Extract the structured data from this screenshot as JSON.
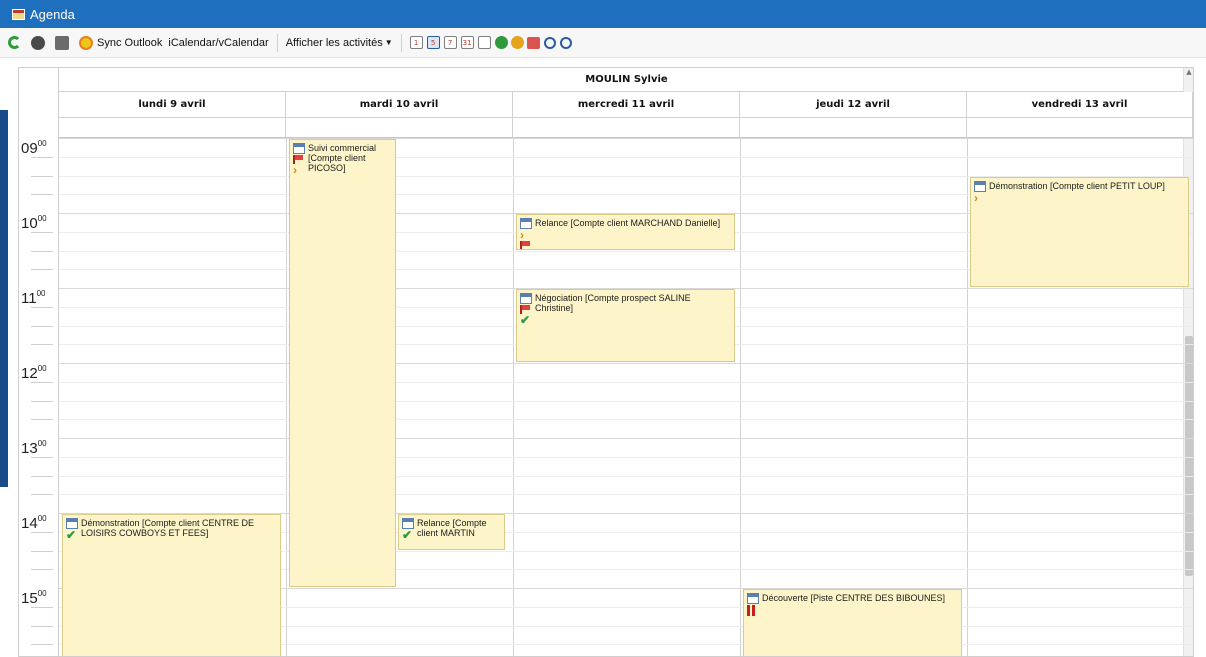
{
  "window": {
    "title": "Agenda"
  },
  "toolbar": {
    "sync_outlook": "Sync Outlook",
    "icalendar": "iCalendar/vCalendar",
    "show_activities": "Afficher les activités",
    "view_day": "1",
    "view_workweek": "5",
    "view_week": "7",
    "view_month": "31"
  },
  "calendar": {
    "owner": "MOULIN Sylvie",
    "days": [
      "lundi 9 avril",
      "mardi 10 avril",
      "mercredi 11 avril",
      "jeudi 12 avril",
      "vendredi 13 avril"
    ],
    "hours": [
      "09",
      "10",
      "11",
      "12",
      "13",
      "14",
      "15"
    ],
    "minutes_label": "00"
  },
  "events": [
    {
      "title": "Suivi commercial [Compte client PICOSO]",
      "day": "mardi 10 avril",
      "start": "09:00",
      "end": "15:00",
      "icons": [
        "calendar-icon",
        "flag-icon",
        "chevron-icon"
      ]
    },
    {
      "title": "Démonstration [Compte client PETIT LOUP]",
      "day": "vendredi 13 avril",
      "start": "09:30",
      "end": "11:00",
      "icons": [
        "calendar-icon",
        "chevron-icon"
      ]
    },
    {
      "title": "Relance [Compte client MARCHAND Danielle]",
      "day": "mercredi 11 avril",
      "start": "10:00",
      "end": "10:30",
      "icons": [
        "calendar-icon",
        "chevron-icon",
        "flag-icon"
      ]
    },
    {
      "title": "Négociation [Compte prospect SALINE Christine]",
      "day": "mercredi 11 avril",
      "start": "11:00",
      "end": "12:00",
      "icons": [
        "calendar-icon",
        "flag-icon",
        "check-icon"
      ]
    },
    {
      "title": "Démonstration [Compte client CENTRE DE LOISIRS COWBOYS ET FEES]",
      "day": "lundi 9 avril",
      "start": "14:00",
      "end": "16:00",
      "icons": [
        "calendar-icon",
        "check-icon"
      ]
    },
    {
      "title": "Relance [Compte client MARTIN",
      "day": "mardi 10 avril",
      "start": "14:00",
      "end": "14:30",
      "icons": [
        "calendar-icon",
        "check-icon"
      ]
    },
    {
      "title": "Découverte [Piste CENTRE DES BIBOUNES]",
      "day": "jeudi 12 avril",
      "start": "15:00",
      "end": "16:00",
      "icons": [
        "calendar-icon",
        "pause-icon"
      ]
    }
  ],
  "colors": {
    "titlebar": "#1f6fbf",
    "event_bg": "#fdf5c9",
    "event_border": "#d9cc88"
  }
}
